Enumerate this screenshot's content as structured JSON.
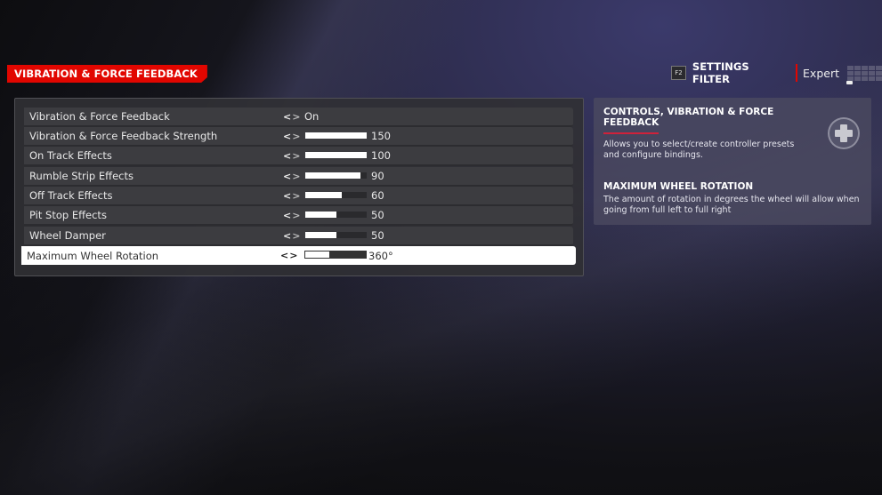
{
  "header": {
    "title": "VIBRATION & FORCE FEEDBACK",
    "filter": {
      "key": "F2",
      "label": "SETTINGS FILTER",
      "value": "Expert"
    }
  },
  "settings": [
    {
      "label": "Vibration & Force Feedback",
      "type": "toggle",
      "value": "On"
    },
    {
      "label": "Vibration & Force Feedback Strength",
      "type": "slider",
      "value": "150",
      "fill": 1.0
    },
    {
      "label": "On Track Effects",
      "type": "slider",
      "value": "100",
      "fill": 1.0
    },
    {
      "label": "Rumble Strip Effects",
      "type": "slider",
      "value": "90",
      "fill": 0.9
    },
    {
      "label": "Off Track Effects",
      "type": "slider",
      "value": "60",
      "fill": 0.6
    },
    {
      "label": "Pit Stop Effects",
      "type": "slider",
      "value": "50",
      "fill": 0.5
    },
    {
      "label": "Wheel Damper",
      "type": "slider",
      "value": "50",
      "fill": 0.5
    },
    {
      "label": "Maximum Wheel Rotation",
      "type": "slider",
      "value": "360°",
      "fill": 0.4,
      "selected": true
    }
  ],
  "arrows": {
    "left": "<",
    "right": ">"
  },
  "info": {
    "title": "CONTROLS, VIBRATION & FORCE FEEDBACK",
    "description": "Allows you to select/create controller presets and configure bindings.",
    "icon": "dpad-icon",
    "sub_title": "MAXIMUM WHEEL ROTATION",
    "sub_description": "The amount of rotation in degrees the wheel will allow when going from full left to full right"
  },
  "colors": {
    "accent": "#e10600",
    "panel": "#303034",
    "row": "#3c3c40",
    "selected_row": "#ffffff"
  }
}
